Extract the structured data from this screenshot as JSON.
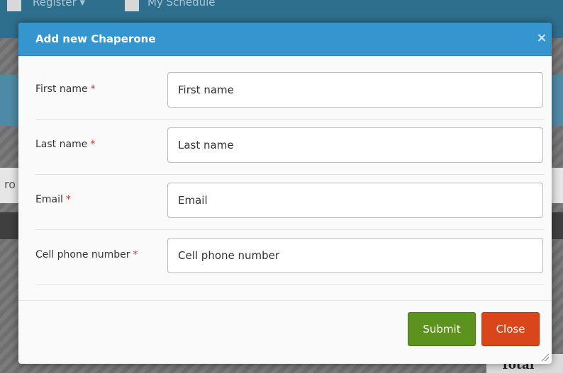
{
  "background": {
    "nav": {
      "register": "Register ▾",
      "schedule": "My Schedule"
    },
    "partial_text": "ro",
    "total_label": "Total"
  },
  "modal": {
    "title": "Add new Chaperone",
    "close_icon": "×",
    "required_marker": "*",
    "fields": [
      {
        "label": "First name",
        "placeholder": "First name"
      },
      {
        "label": "Last name",
        "placeholder": "Last name"
      },
      {
        "label": "Email",
        "placeholder": "Email"
      },
      {
        "label": "Cell phone number",
        "placeholder": "Cell phone number"
      }
    ],
    "buttons": {
      "submit": "Submit",
      "close": "Close"
    }
  },
  "colors": {
    "header": "#3595cf",
    "submit": "#5c931e",
    "close": "#d9461c",
    "required": "#d9302c"
  }
}
